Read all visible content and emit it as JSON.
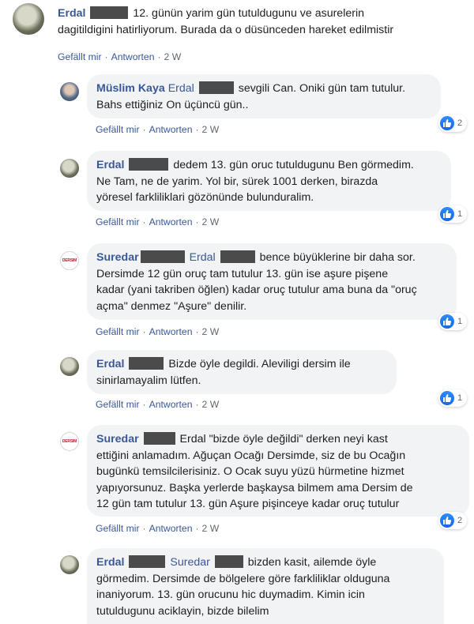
{
  "comments": [
    {
      "author": "Erdal",
      "text": "12. günün yarim gün tutuldugunu ve asurelerin dagitildigini hatirliyorum. Burada da o düsünceden hareket edilmistir",
      "line1": "12. günün yarim gün tutuldugunu ve asurelerin",
      "line2": "dagitildigini hatirliyorum. Burada da o düsünceden hareket edilmistir",
      "like": "Gefällt mir",
      "reply": "Antworten",
      "time": "2 W"
    },
    {
      "author": "Müslim Kaya",
      "mention": "Erdal",
      "line1": "sevgili Can. Oniki gün tam tutulur.",
      "line2": "Bahs ettiğiniz On üçüncü gün..",
      "like": "Gefällt mir",
      "reply": "Antworten",
      "time": "2 W",
      "reactions": "2"
    },
    {
      "author": "Erdal",
      "line1": "dedem 13. gün oruc tutuldugunu Ben görmedim.",
      "line2": "Ne Tam, ne de yarim. Yol bir, sürek 1001 derken, birazda",
      "line3": "yöresel farkliliklari gözönünde bulunduralim.",
      "like": "Gefällt mir",
      "reply": "Antworten",
      "time": "2 W",
      "reactions": "1"
    },
    {
      "author": "Suredar",
      "mention": "Erdal",
      "line1": "bence büyüklerine bir daha sor.",
      "line2": "Dersimde 12 gün oruç tam tutulur 13. gün ise aşure pişene",
      "line3": "kadar (yani takriben öğlen) kadar oruç tutulur ama buna da \"oruç",
      "line4": "açma\" denmez \"Aşure\" denilir.",
      "like": "Gefällt mir",
      "reply": "Antworten",
      "time": "2 W",
      "reactions": "1"
    },
    {
      "author": "Erdal",
      "line1": "Bizde öyle degildi. Aleviligi dersim ile",
      "line2": "sinirlamayalim lütfen.",
      "like": "Gefällt mir",
      "reply": "Antworten",
      "time": "2 W",
      "reactions": "1"
    },
    {
      "author": "Suredar",
      "line1": "Erdal \"bizde öyle değildi\" derken neyi kast",
      "line2": "ettiğini anlamadım. Ağuçan Ocağı Dersimde, siz de bu Ocağın",
      "line3": "bugünkü temsilcilerisiniz. O Ocak suyu yüzü hürmetine hizmet",
      "line4": "yapıyorsunuz. Başka yerlerde başkaysa bilmem ama Dersim de",
      "line5": "12 gün tam tutulur 13. gün Aşure pişinceye kadar oruç tutulur",
      "like": "Gefällt mir",
      "reply": "Antworten",
      "time": "2 W",
      "reactions": "2"
    },
    {
      "author": "Erdal",
      "mention": "Suredar",
      "line1": "bizden kasit, ailemde öyle",
      "line2": "görmedim. Dersimde de bölgelere göre farkliliklar olduguna",
      "line3": "inaniyorum. 13. gün orucunu hic duymadim. Kimin icin",
      "line4": "tutuldugunu aciklayin, bizde bilelim"
    }
  ],
  "avatar_suredar_text": "DERSIM",
  "colors": {
    "link": "#385898",
    "bubble": "#f2f3f5",
    "like": "#1877f2"
  },
  "icons": {
    "reaction": "like-thumb-icon"
  }
}
